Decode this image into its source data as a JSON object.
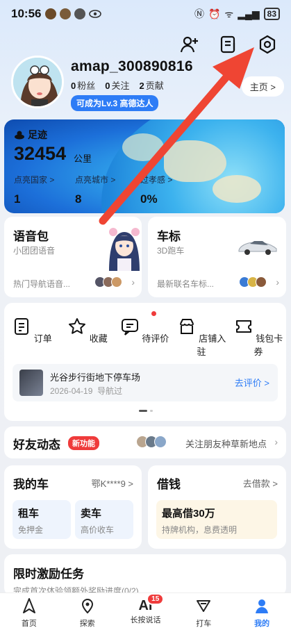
{
  "status_bar": {
    "time": "10:56",
    "battery": "83"
  },
  "profile": {
    "username": "amap_300890816",
    "fans_count": "0",
    "fans_label": "粉丝",
    "follow_count": "0",
    "follow_label": "关注",
    "contrib_count": "2",
    "contrib_label": "贡献",
    "level_badge": "可成为Lv.3 高德达人",
    "home_button": "主页 >"
  },
  "footprint": {
    "title": "足迹",
    "distance": "32454",
    "unit": "公里",
    "countries_label": "点亮国家 >",
    "countries_value": "1",
    "cities_label": "点亮城市 >",
    "cities_value": "8",
    "third_label": "过孝感 >",
    "third_value": "0%"
  },
  "voice_pack": {
    "title": "语音包",
    "subtitle": "小团团语音",
    "footer": "热门导航语音..."
  },
  "car_logo": {
    "title": "车标",
    "subtitle": "3D跑车",
    "footer": "最新联名车标..."
  },
  "orders": {
    "items": [
      "订单",
      "收藏",
      "待评价",
      "店铺入驻",
      "钱包卡券"
    ],
    "review_title": "光谷步行街地下停车场",
    "review_date": "2026-04-19",
    "review_note": "导航过",
    "review_action": "去评价 >"
  },
  "friends": {
    "title": "好友动态",
    "new_tag": "新功能",
    "text": "关注朋友种草新地点"
  },
  "my_car": {
    "title": "我的车",
    "plate": "鄂K****9 >",
    "tile1_title": "租车",
    "tile1_sub": "免押金",
    "tile2_title": "卖车",
    "tile2_sub": "高价收车"
  },
  "loan": {
    "title": "借钱",
    "more": "去借款 >",
    "tile_title": "最高借30万",
    "tile_sub": "持牌机构，息费透明"
  },
  "tasks": {
    "title": "限时激励任务",
    "subtitle": "完成首次体验领额外奖励进度(0/2)"
  },
  "bottom_nav": {
    "home": "首页",
    "explore": "探索",
    "ai_glyph": "Ai",
    "ai_label": "长按说话",
    "ai_badge": "15",
    "taxi": "打车",
    "mine": "我的"
  },
  "colors": {
    "accent": "#2d7cf6",
    "alert": "#ef3b3b",
    "arrow": "#ef4533"
  }
}
